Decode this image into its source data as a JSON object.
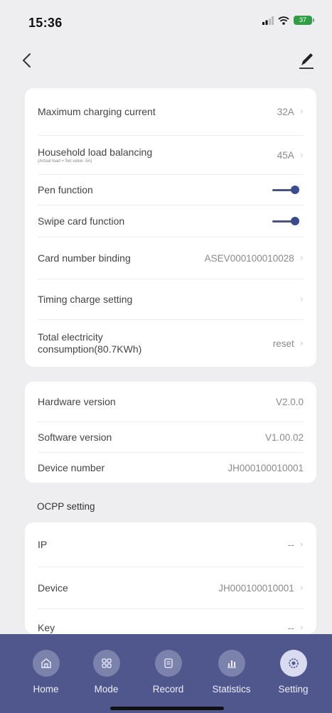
{
  "status_bar": {
    "time": "15:36",
    "battery": "37"
  },
  "settings_card": {
    "rows": [
      {
        "label": "Maximum charging current",
        "value": "32A"
      },
      {
        "label": "Household load balancing",
        "sublabel": "(Actual load = Set value -5A)",
        "value": "45A"
      },
      {
        "label": "Pen function",
        "toggle_on": true
      },
      {
        "label": "Swipe card function",
        "toggle_on": true
      },
      {
        "label": "Card number binding",
        "value": "ASEV000100010028"
      },
      {
        "label": "Timing charge setting",
        "value": ""
      },
      {
        "label": "Total electricity consumption(80.7KWh)",
        "value": "reset"
      }
    ]
  },
  "version_card": {
    "rows": [
      {
        "label": "Hardware version",
        "value": "V2.0.0"
      },
      {
        "label": "Software version",
        "value": "V1.00.02"
      },
      {
        "label": "Device number",
        "value": "JH000100010001"
      }
    ]
  },
  "ocpp": {
    "title": "OCPP setting",
    "rows": [
      {
        "label": "IP",
        "value": "--"
      },
      {
        "label": "Device",
        "value": "JH000100010001"
      },
      {
        "label": "Key",
        "value": "--"
      }
    ]
  },
  "tabbar": {
    "tabs": [
      {
        "label": "Home",
        "icon": "home-icon"
      },
      {
        "label": "Mode",
        "icon": "grid-icon"
      },
      {
        "label": "Record",
        "icon": "record-icon"
      },
      {
        "label": "Statistics",
        "icon": "chart-icon"
      },
      {
        "label": "Setting",
        "icon": "gear-icon",
        "active": true
      }
    ]
  },
  "colors": {
    "accent": "#3c4a8f",
    "tabbar": "#4f578c",
    "background": "#eeeef1"
  }
}
